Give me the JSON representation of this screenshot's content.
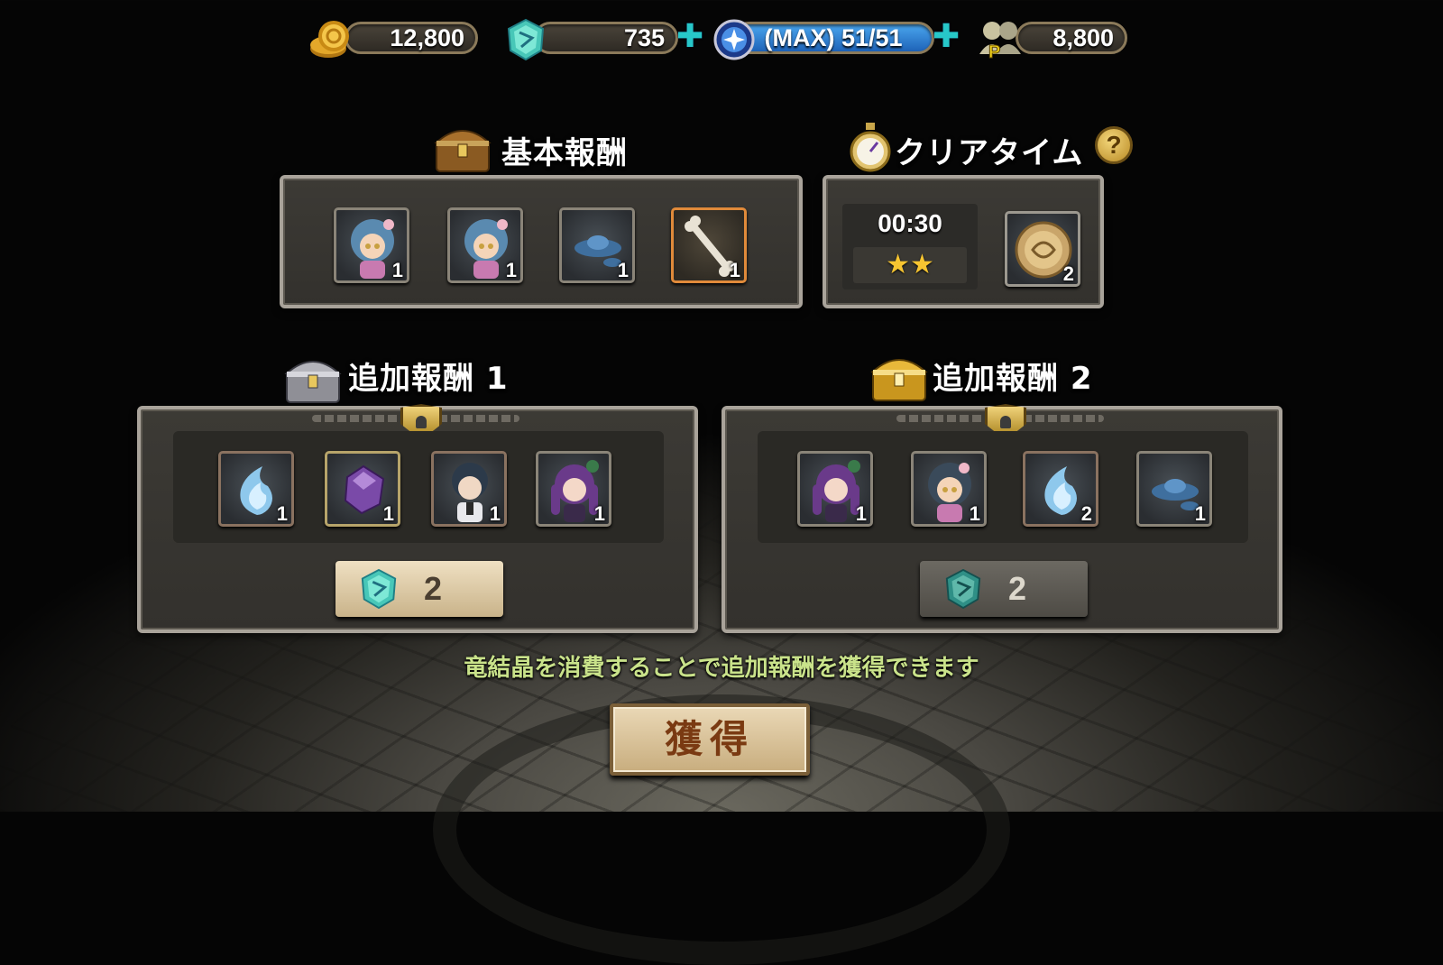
{
  "currencies": {
    "gold": {
      "value": "12,800",
      "icon": "gold-coins-icon"
    },
    "crystal": {
      "value": "735",
      "icon": "dragon-crystal-icon"
    },
    "stamina": {
      "value": "(MAX) 51/51",
      "icon": "stamina-orb-icon"
    },
    "points": {
      "value": "8,800",
      "icon": "friend-points-icon",
      "badge": "P"
    }
  },
  "basic_reward": {
    "title": "基本報酬",
    "items": [
      {
        "icon": "blue-hair-girl-icon",
        "qty": "1"
      },
      {
        "icon": "blue-hair-girl-icon",
        "qty": "1"
      },
      {
        "icon": "blue-slime-icon",
        "qty": "1"
      },
      {
        "icon": "bone-icon",
        "qty": "1"
      }
    ]
  },
  "clear_time": {
    "title": "クリアタイム",
    "time": "00:30",
    "stars": "★★",
    "medal_qty": "2",
    "help": "?"
  },
  "extra_reward_1": {
    "title": "追加報酬 1",
    "items": [
      {
        "icon": "blue-spirit-flame-icon",
        "qty": "1"
      },
      {
        "icon": "purple-gem-icon",
        "qty": "1"
      },
      {
        "icon": "dark-hair-boy-icon",
        "qty": "1"
      },
      {
        "icon": "purple-hair-girl-icon",
        "qty": "1"
      }
    ],
    "cost": "2"
  },
  "extra_reward_2": {
    "title": "追加報酬 2",
    "items": [
      {
        "icon": "purple-hair-girl-icon",
        "qty": "1"
      },
      {
        "icon": "dark-hair-girl-icon",
        "qty": "1"
      },
      {
        "icon": "blue-spirit-flame-icon",
        "qty": "2"
      },
      {
        "icon": "blue-slime-icon",
        "qty": "1"
      }
    ],
    "cost": "2"
  },
  "info_text": "竜結晶を消費することで追加報酬を獲得できます",
  "acquire_label": "獲得",
  "colors": {
    "accent_plus": "#27c7c9",
    "info_text": "#c9e28a",
    "star": "#f7c531",
    "slot_highlight": "#e08a3a"
  }
}
